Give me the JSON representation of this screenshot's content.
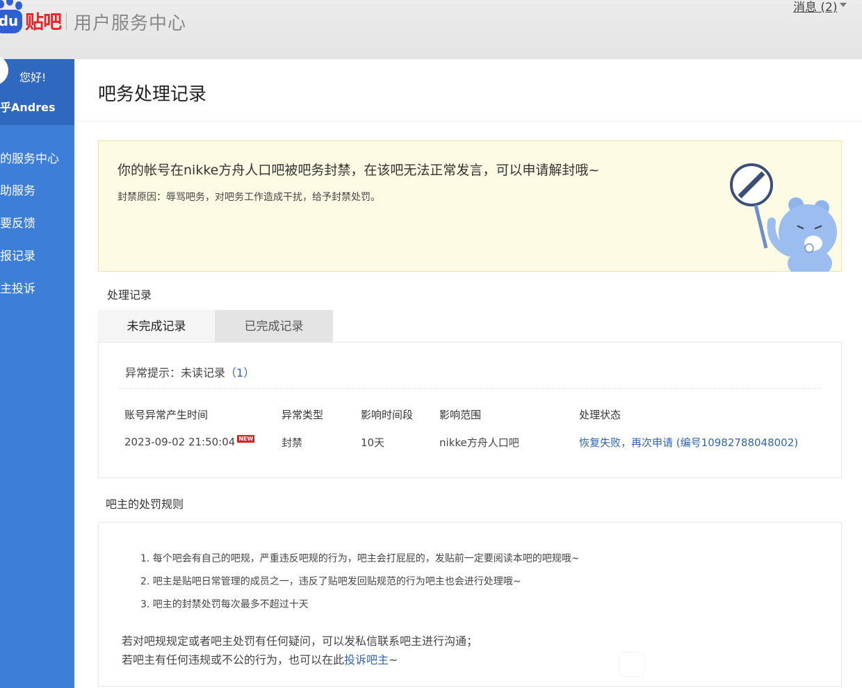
{
  "header": {
    "logo_du": "du",
    "logo_tieba": "贴吧",
    "subtitle": "用户服务中心",
    "messages_link": "消息 (2)"
  },
  "sidebar": {
    "greeting": "您好!",
    "username": "乎Andres",
    "items": [
      {
        "label": "的服务中心"
      },
      {
        "label": "助服务"
      },
      {
        "label": "要反馈"
      },
      {
        "label": "报记录"
      },
      {
        "label": "主投诉"
      }
    ]
  },
  "main": {
    "title": "吧务处理记录",
    "notice": {
      "message": "你的帐号在nikke方舟人口吧被吧务封禁，在该吧无法正常发言，可以申请解封哦~",
      "reason": "封禁原因：辱骂吧务，对吧务工作造成干扰，给予封禁处罚。"
    },
    "records_title": "处理记录",
    "tabs": [
      {
        "label": "未完成记录"
      },
      {
        "label": "已完成记录"
      }
    ],
    "alert": {
      "label": "异常提示：未读记录",
      "count": "（1）"
    },
    "table": {
      "headers": [
        "账号异常产生时间",
        "异常类型",
        "影响时间段",
        "影响范围",
        "处理状态"
      ],
      "rows": [
        {
          "time": "2023-09-02 21:50:04",
          "badge": "NEW",
          "type": "封禁",
          "duration": "10天",
          "scope": "nikke方舟人口吧",
          "status_fail": "恢复失败，",
          "status_reapply": "再次申请",
          "status_id": " (编号10982788048002)"
        }
      ]
    },
    "rules_title": "吧主的处罚规则",
    "rules": [
      "1. 每个吧会有自己的吧规，严重违反吧规的行为，吧主会打屁屁的，发贴前一定要阅读本吧的吧规哦~",
      "2. 吧主是贴吧日常管理的成员之一，违反了贴吧发回贴规范的行为吧主也会进行处理哦~",
      "3. 吧主的封禁处罚每次最多不超过十天"
    ],
    "rules_footer_1": "若对吧规规定或者吧主处罚有任何疑问，可以发私信联系吧主进行沟通；",
    "rules_footer_2_prefix": "若吧主有任何违规或不公的行为，也可以在此",
    "rules_footer_2_link": "投诉吧主",
    "rules_footer_2_suffix": "~"
  },
  "colors": {
    "sidebar": "#3d7ed8",
    "sidebar_top": "#2f68bf",
    "link": "#2d64b3",
    "brand_red": "#e4262a",
    "notice_bg": "#fefbe4"
  }
}
